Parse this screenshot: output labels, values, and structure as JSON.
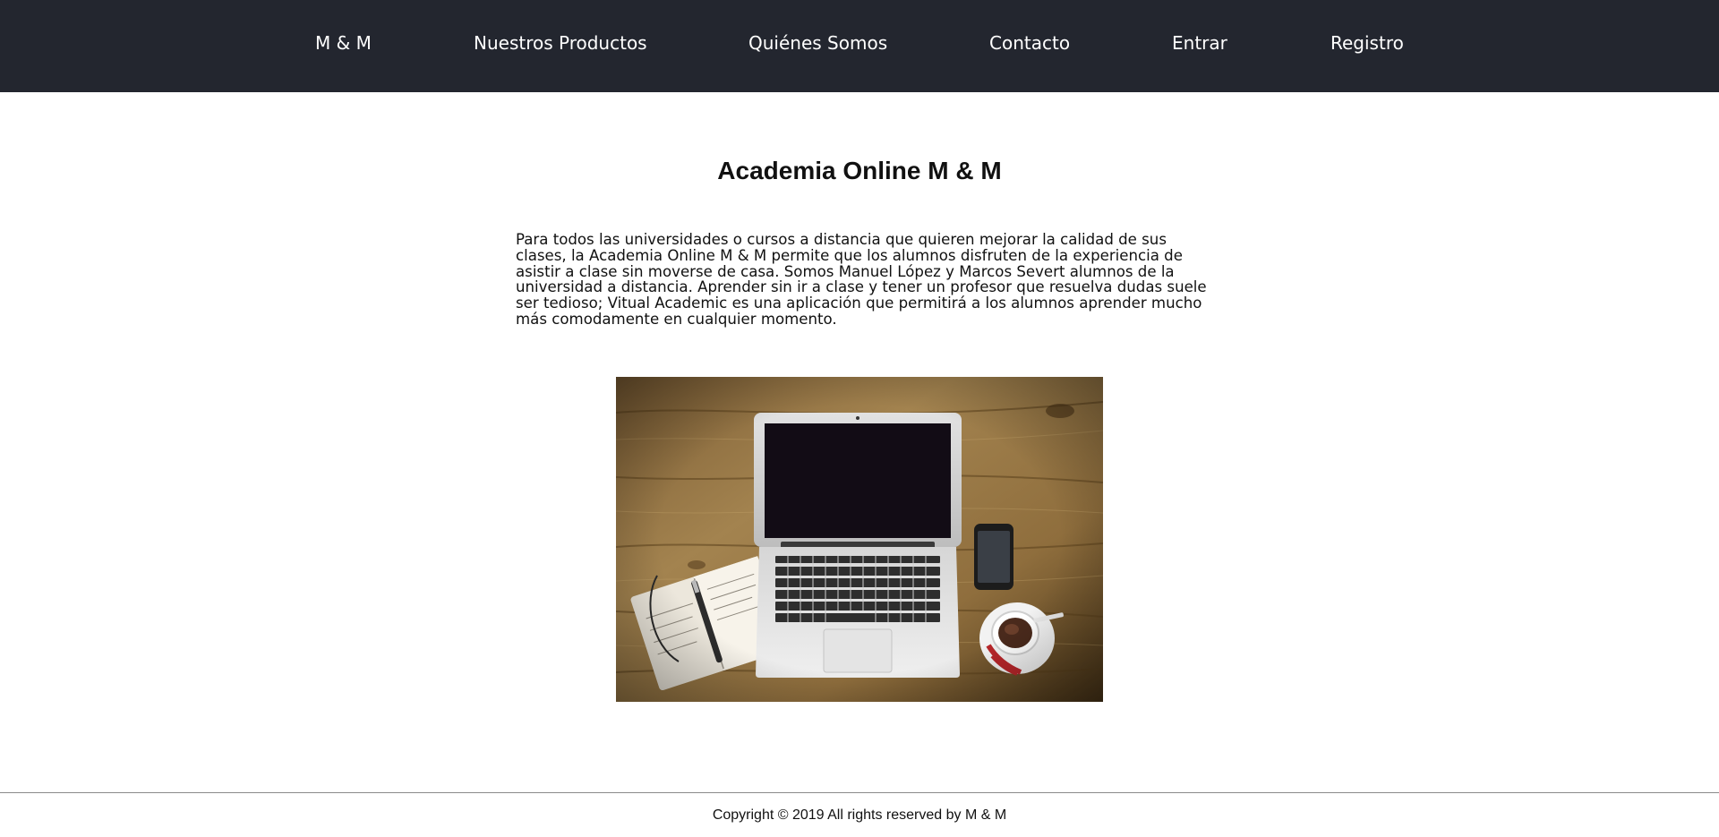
{
  "nav": {
    "brand": "M & M",
    "products": "Nuestros Productos",
    "about": "Quiénes Somos",
    "contact": "Contacto",
    "login": "Entrar",
    "register": "Registro"
  },
  "main": {
    "title": "Academia Online M & M",
    "intro": "Para todos las universidades o cursos a distancia que quieren mejorar la calidad de sus clases, la Academia Online M & M permite que los alumnos disfruten de la experiencia de asistir a clase sin moverse de casa. Somos Manuel López y Marcos Severt alumnos de la universidad a distancia. Aprender sin ir a clase y tener un profesor que resuelva dudas suele ser tedioso; Vitual Academic es una aplicación que permitirá a los alumnos aprender mucho más comodamente en cualquier momento.",
    "image_alt": "laptop-desk-photo"
  },
  "footer": {
    "copyright": "Copyright © 2019 All rights reserved by M & M"
  },
  "colors": {
    "navbar_bg": "#23262f",
    "nav_text": "#ffffff",
    "body_bg": "#ffffff",
    "text": "#111111",
    "footer_rule": "#8a8a8a"
  }
}
